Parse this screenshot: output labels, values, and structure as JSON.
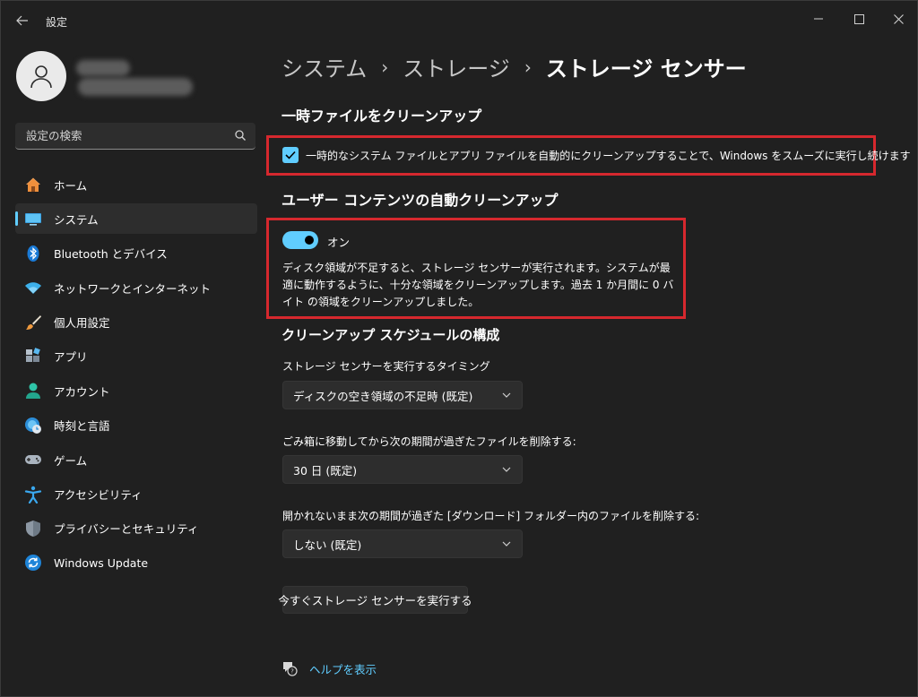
{
  "window": {
    "app_title": "設定",
    "back_icon": "back-arrow-icon",
    "controls": [
      "minimize-icon",
      "maximize-icon",
      "close-icon"
    ]
  },
  "sidebar": {
    "search_placeholder": "設定の検索",
    "items": [
      {
        "label": "ホーム",
        "icon": "home-icon",
        "active": false
      },
      {
        "label": "システム",
        "icon": "system-monitor-icon",
        "active": true
      },
      {
        "label": "Bluetooth とデバイス",
        "icon": "bluetooth-icon",
        "active": false
      },
      {
        "label": "ネットワークとインターネット",
        "icon": "wifi-icon",
        "active": false
      },
      {
        "label": "個人用設定",
        "icon": "paintbrush-icon",
        "active": false
      },
      {
        "label": "アプリ",
        "icon": "apps-icon",
        "active": false
      },
      {
        "label": "アカウント",
        "icon": "account-icon",
        "active": false
      },
      {
        "label": "時刻と言語",
        "icon": "globe-clock-icon",
        "active": false
      },
      {
        "label": "ゲーム",
        "icon": "gamepad-icon",
        "active": false
      },
      {
        "label": "アクセシビリティ",
        "icon": "accessibility-icon",
        "active": false
      },
      {
        "label": "プライバシーとセキュリティ",
        "icon": "shield-icon",
        "active": false
      },
      {
        "label": "Windows Update",
        "icon": "windows-update-icon",
        "active": false
      }
    ]
  },
  "breadcrumb": [
    "システム",
    "ストレージ",
    "ストレージ センサー"
  ],
  "temp_cleanup": {
    "heading": "一時ファイルをクリーンアップ",
    "checkbox_label": "一時的なシステム ファイルとアプリ ファイルを自動的にクリーンアップすることで、Windows をスムーズに実行し続けます",
    "checked": true
  },
  "auto_cleanup": {
    "heading": "ユーザー コンテンツの自動クリーンアップ",
    "toggle_label": "オン",
    "toggle_on": true,
    "description": "ディスク領域が不足すると、ストレージ センサーが実行されます。システムが最適に動作するように、十分な領域をクリーンアップします。過去 1 か月間に 0 バイト の領域をクリーンアップしました。"
  },
  "schedule": {
    "heading": "クリーンアップ スケジュールの構成",
    "run_label": "ストレージ センサーを実行するタイミング",
    "run_value": "ディスクの空き領域の不足時 (既定)",
    "recycle_label": "ごみ箱に移動してから次の期間が過ぎたファイルを削除する:",
    "recycle_value": "30 日 (既定)",
    "downloads_label": "開かれないまま次の期間が過ぎた [ダウンロード] フォルダー内のファイルを削除する:",
    "downloads_value": "しない (既定)",
    "run_now_button": "今すぐストレージ センサーを実行する"
  },
  "help": {
    "link": "ヘルプを表示",
    "icon": "help-icon"
  },
  "colors": {
    "accent": "#60cdff",
    "highlight_border": "#d6282e",
    "background": "#202020"
  }
}
